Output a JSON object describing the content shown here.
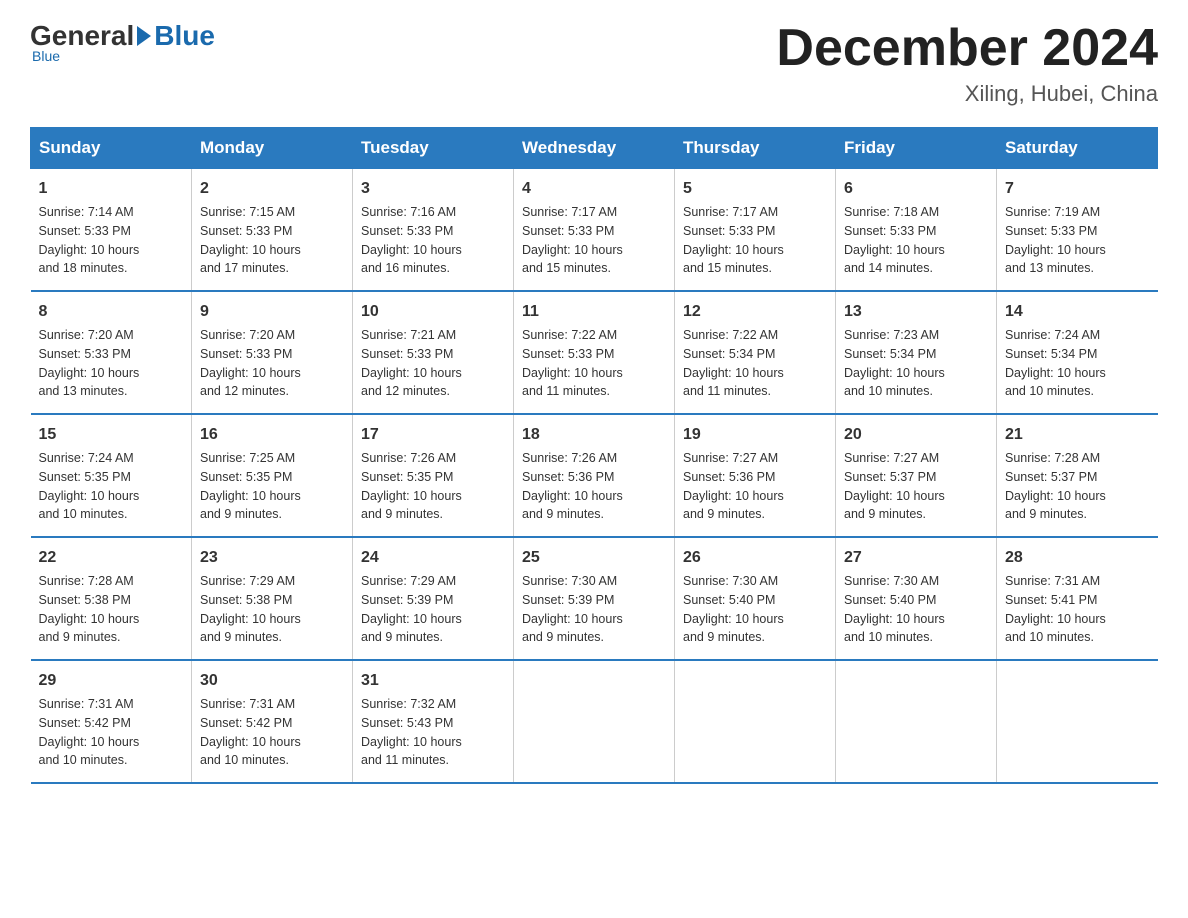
{
  "logo": {
    "general": "General",
    "blue": "Blue"
  },
  "title": "December 2024",
  "location": "Xiling, Hubei, China",
  "days_of_week": [
    "Sunday",
    "Monday",
    "Tuesday",
    "Wednesday",
    "Thursday",
    "Friday",
    "Saturday"
  ],
  "weeks": [
    [
      {
        "day": "1",
        "info": "Sunrise: 7:14 AM\nSunset: 5:33 PM\nDaylight: 10 hours\nand 18 minutes."
      },
      {
        "day": "2",
        "info": "Sunrise: 7:15 AM\nSunset: 5:33 PM\nDaylight: 10 hours\nand 17 minutes."
      },
      {
        "day": "3",
        "info": "Sunrise: 7:16 AM\nSunset: 5:33 PM\nDaylight: 10 hours\nand 16 minutes."
      },
      {
        "day": "4",
        "info": "Sunrise: 7:17 AM\nSunset: 5:33 PM\nDaylight: 10 hours\nand 15 minutes."
      },
      {
        "day": "5",
        "info": "Sunrise: 7:17 AM\nSunset: 5:33 PM\nDaylight: 10 hours\nand 15 minutes."
      },
      {
        "day": "6",
        "info": "Sunrise: 7:18 AM\nSunset: 5:33 PM\nDaylight: 10 hours\nand 14 minutes."
      },
      {
        "day": "7",
        "info": "Sunrise: 7:19 AM\nSunset: 5:33 PM\nDaylight: 10 hours\nand 13 minutes."
      }
    ],
    [
      {
        "day": "8",
        "info": "Sunrise: 7:20 AM\nSunset: 5:33 PM\nDaylight: 10 hours\nand 13 minutes."
      },
      {
        "day": "9",
        "info": "Sunrise: 7:20 AM\nSunset: 5:33 PM\nDaylight: 10 hours\nand 12 minutes."
      },
      {
        "day": "10",
        "info": "Sunrise: 7:21 AM\nSunset: 5:33 PM\nDaylight: 10 hours\nand 12 minutes."
      },
      {
        "day": "11",
        "info": "Sunrise: 7:22 AM\nSunset: 5:33 PM\nDaylight: 10 hours\nand 11 minutes."
      },
      {
        "day": "12",
        "info": "Sunrise: 7:22 AM\nSunset: 5:34 PM\nDaylight: 10 hours\nand 11 minutes."
      },
      {
        "day": "13",
        "info": "Sunrise: 7:23 AM\nSunset: 5:34 PM\nDaylight: 10 hours\nand 10 minutes."
      },
      {
        "day": "14",
        "info": "Sunrise: 7:24 AM\nSunset: 5:34 PM\nDaylight: 10 hours\nand 10 minutes."
      }
    ],
    [
      {
        "day": "15",
        "info": "Sunrise: 7:24 AM\nSunset: 5:35 PM\nDaylight: 10 hours\nand 10 minutes."
      },
      {
        "day": "16",
        "info": "Sunrise: 7:25 AM\nSunset: 5:35 PM\nDaylight: 10 hours\nand 9 minutes."
      },
      {
        "day": "17",
        "info": "Sunrise: 7:26 AM\nSunset: 5:35 PM\nDaylight: 10 hours\nand 9 minutes."
      },
      {
        "day": "18",
        "info": "Sunrise: 7:26 AM\nSunset: 5:36 PM\nDaylight: 10 hours\nand 9 minutes."
      },
      {
        "day": "19",
        "info": "Sunrise: 7:27 AM\nSunset: 5:36 PM\nDaylight: 10 hours\nand 9 minutes."
      },
      {
        "day": "20",
        "info": "Sunrise: 7:27 AM\nSunset: 5:37 PM\nDaylight: 10 hours\nand 9 minutes."
      },
      {
        "day": "21",
        "info": "Sunrise: 7:28 AM\nSunset: 5:37 PM\nDaylight: 10 hours\nand 9 minutes."
      }
    ],
    [
      {
        "day": "22",
        "info": "Sunrise: 7:28 AM\nSunset: 5:38 PM\nDaylight: 10 hours\nand 9 minutes."
      },
      {
        "day": "23",
        "info": "Sunrise: 7:29 AM\nSunset: 5:38 PM\nDaylight: 10 hours\nand 9 minutes."
      },
      {
        "day": "24",
        "info": "Sunrise: 7:29 AM\nSunset: 5:39 PM\nDaylight: 10 hours\nand 9 minutes."
      },
      {
        "day": "25",
        "info": "Sunrise: 7:30 AM\nSunset: 5:39 PM\nDaylight: 10 hours\nand 9 minutes."
      },
      {
        "day": "26",
        "info": "Sunrise: 7:30 AM\nSunset: 5:40 PM\nDaylight: 10 hours\nand 9 minutes."
      },
      {
        "day": "27",
        "info": "Sunrise: 7:30 AM\nSunset: 5:40 PM\nDaylight: 10 hours\nand 10 minutes."
      },
      {
        "day": "28",
        "info": "Sunrise: 7:31 AM\nSunset: 5:41 PM\nDaylight: 10 hours\nand 10 minutes."
      }
    ],
    [
      {
        "day": "29",
        "info": "Sunrise: 7:31 AM\nSunset: 5:42 PM\nDaylight: 10 hours\nand 10 minutes."
      },
      {
        "day": "30",
        "info": "Sunrise: 7:31 AM\nSunset: 5:42 PM\nDaylight: 10 hours\nand 10 minutes."
      },
      {
        "day": "31",
        "info": "Sunrise: 7:32 AM\nSunset: 5:43 PM\nDaylight: 10 hours\nand 11 minutes."
      },
      {
        "day": "",
        "info": ""
      },
      {
        "day": "",
        "info": ""
      },
      {
        "day": "",
        "info": ""
      },
      {
        "day": "",
        "info": ""
      }
    ]
  ]
}
